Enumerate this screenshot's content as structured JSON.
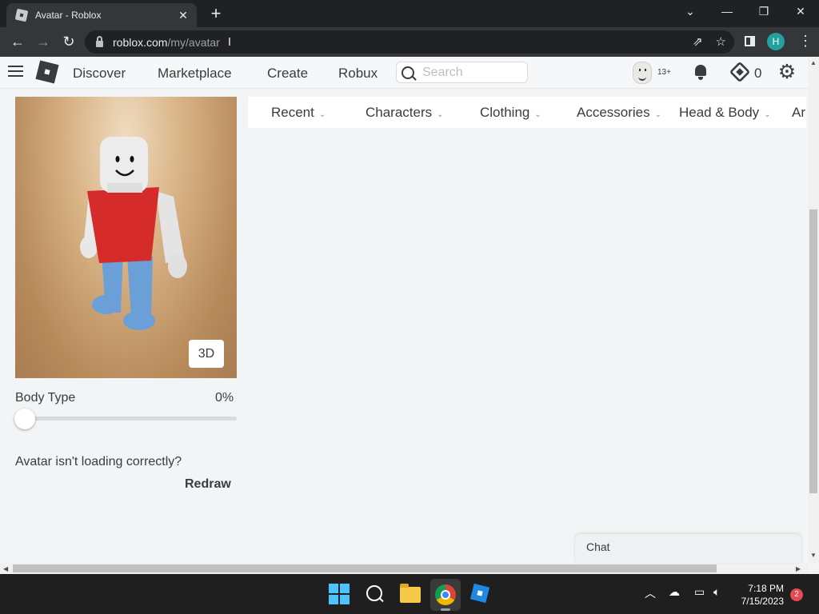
{
  "browser": {
    "tab_title": "Avatar - Roblox",
    "url_host": "roblox.com",
    "url_path": "/my/avatar",
    "profile_initial": "H"
  },
  "header": {
    "nav": [
      "Discover",
      "Marketplace",
      "Create",
      "Robux"
    ],
    "search_placeholder": "Search",
    "age_badge": "13+",
    "robux_balance": "0"
  },
  "avatar": {
    "view_toggle": "3D",
    "body_type_label": "Body Type",
    "body_type_value": "0%",
    "body_type_fraction": 0,
    "help_text": "Avatar isn't loading correctly?",
    "redraw_label": "Redraw"
  },
  "categories": [
    "Recent",
    "Characters",
    "Clothing",
    "Accessories",
    "Head & Body",
    "Ar"
  ],
  "chat": {
    "label": "Chat"
  },
  "taskbar": {
    "time": "7:18 PM",
    "date": "7/15/2023",
    "notification_count": "2"
  },
  "colors": {
    "shirt": "#d52b2b",
    "pants": "#6a9fd8",
    "accent_teal": "#20a39e"
  }
}
